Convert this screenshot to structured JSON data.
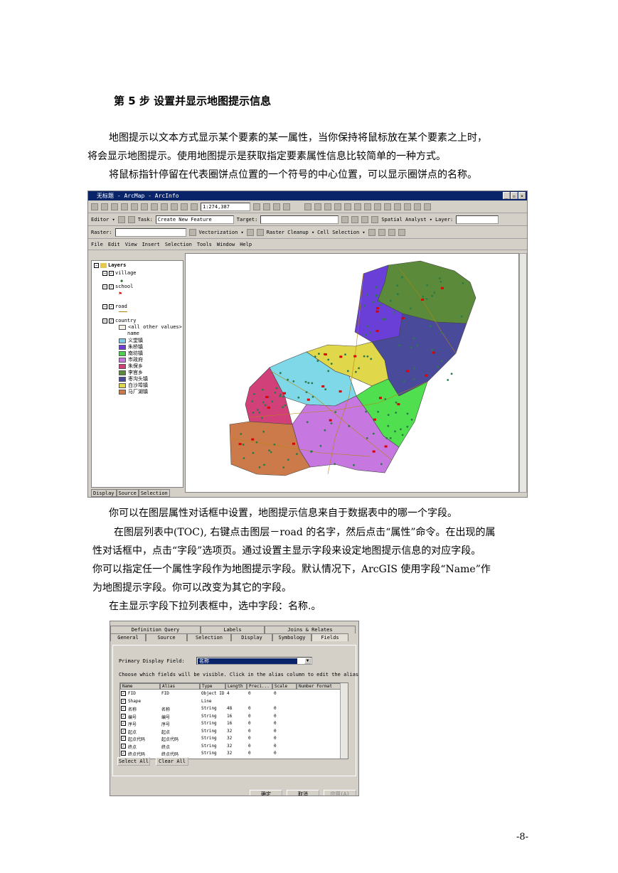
{
  "heading": "第 5 步  设置并显示地图提示信息",
  "paragraphs": {
    "p1_l1": "地图提示以文本方式显示某个要素的某一属性，当你保持将鼠标放在某个要素之上时，",
    "p1_l2": "将会显示地图提示。使用地图提示是获取指定要素属性信息比较简单的一种方式。",
    "p2": "将鼠标指针停留在代表圈饼点位置的一个符号的中心位置，可以显示圈饼点的名称。",
    "p3": "你可以在图层属性对话框中设置，地图提示信息来自于数据表中的哪一个字段。",
    "p4_l1": "在图层列表中(TOC), 右键点击图层－road 的名字，然后点击“属性”命令。在出现的属",
    "p4_l2": "性对话框中，点击“字段”选项页。通过设置主显示字段来设定地图提示信息的对应字段。",
    "p4_l3": "你可以指定任一个属性字段作为地图提示字段。默认情况下，ArcGIS 使用字段“Name”作",
    "p4_l4": "为地图提示字段。你可以改变为其它的字段。",
    "p5": "在主显示字段下拉列表框中，选中字段：名称.。"
  },
  "page_number": "-8-",
  "arcmap": {
    "title": "无标题 - ArcMap - ArcInfo",
    "scale": "1:274,387",
    "editor_label": "Editor ▾",
    "task_label": "Task:",
    "task_value": "Create New Feature",
    "target_label": "Target:",
    "spatial_analyst": "Spatial Analyst ▾",
    "layer_label": "Layer:",
    "raster_label": "Raster:",
    "vectorization": "Vectorization ▾",
    "raster_cleanup": "Raster Cleanup ▾",
    "cell_selection": "Cell Selection ▾",
    "menus": [
      "File",
      "Edit",
      "View",
      "Insert",
      "Selection",
      "Tools",
      "Window",
      "Help"
    ],
    "toc": {
      "root": "Layers",
      "village": "village",
      "school": "school",
      "road": "road",
      "country": "country",
      "all_other": "<all other values>",
      "name_field": "name",
      "legend": [
        {
          "label": "义堂镇",
          "color": "#7fc8e8"
        },
        {
          "label": "朱桥镇",
          "color": "#6a3fd8"
        },
        {
          "label": "南坊镇",
          "color": "#4fcf4f"
        },
        {
          "label": "市政府",
          "color": "#c777e0"
        },
        {
          "label": "朱保乡",
          "color": "#d2407a"
        },
        {
          "label": "李官乡",
          "color": "#5a8a3a"
        },
        {
          "label": "枣沟头镇",
          "color": "#4a4a9a"
        },
        {
          "label": "白沙埠镇",
          "color": "#e0d84a"
        },
        {
          "label": "马厂湖镇",
          "color": "#cc7a4a"
        }
      ],
      "tabs": [
        "Display",
        "Source",
        "Selection"
      ]
    }
  },
  "dialog": {
    "tabs_top": [
      "Definition Query",
      "Labels",
      "Joins & Relates"
    ],
    "tabs_bottom": [
      "General",
      "Source",
      "Selection",
      "Display",
      "Symbology",
      "Fields"
    ],
    "primary_label": "Primary Display Field:",
    "primary_value": "名称",
    "instructions": "Choose which fields will be visible. Click in the alias column to edit the alias for",
    "columns": [
      "Name",
      "Alias",
      "Type",
      "Length",
      "Preci...",
      "Scale",
      "Number Format"
    ],
    "rows": [
      [
        "FID",
        "FID",
        "Object ID",
        "4",
        "0",
        "0"
      ],
      [
        "Shape",
        "",
        "Line",
        "",
        "",
        ""
      ],
      [
        "名称",
        "名称",
        "String",
        "48",
        "0",
        "0"
      ],
      [
        "编号",
        "编号",
        "String",
        "16",
        "0",
        "0"
      ],
      [
        "序号",
        "序号",
        "String",
        "16",
        "0",
        "0"
      ],
      [
        "起点",
        "起点",
        "String",
        "32",
        "0",
        "0"
      ],
      [
        "起点代码",
        "起点代码",
        "String",
        "32",
        "0",
        "0"
      ],
      [
        "终点",
        "终点",
        "String",
        "32",
        "0",
        "0"
      ],
      [
        "终点代码",
        "终点代码",
        "String",
        "32",
        "0",
        "0"
      ]
    ],
    "select_all": "Select All",
    "clear_all": "Clear All",
    "ok": "确定",
    "cancel": "取消",
    "apply": "应用(A)"
  }
}
